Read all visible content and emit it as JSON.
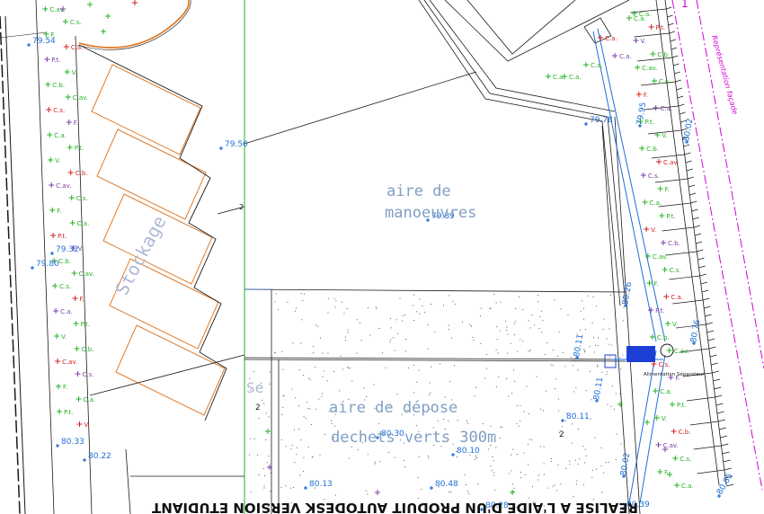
{
  "plan": {
    "areas": {
      "manoeuvre_line1": "aire de",
      "manoeuvre_line2": "manoeuvres",
      "depose_line1": "aire de dépose",
      "depose_line2": "dechets verts 300m",
      "depose_exp": "2",
      "stockage": "Stockage",
      "partial_se": "Se",
      "partial_2": "2"
    },
    "annotations": {
      "alimentation": "Alimentation Séparateur",
      "facade": "Représentation façade",
      "watermark": "REALISE A L'AIDE D'UN PRODUIT AUTODESK VERSION ETUDIANT",
      "red_number": "1"
    },
    "elevations": {
      "e1": "79.54",
      "e2": "79.50",
      "e3": "79.89",
      "e4": "79.32",
      "e5": "79.80",
      "e6": "79.78",
      "e7": "79.95",
      "e8": "80.02",
      "e9": "80.26",
      "e10": "80.11",
      "e11": "80.76",
      "e12": "80.11",
      "e13": "80.11",
      "e14": "80.30",
      "e15": "80.10",
      "e16": "80.33",
      "e17": "80.22",
      "e18": "80.13",
      "e19": "80.48",
      "e20": "80.28",
      "e21": "80.02",
      "e22": "80.39",
      "e23": "80.85"
    },
    "colors": {
      "line": "#1a1a1a",
      "blue": "#1e6fd6",
      "orange": "#e07b2a",
      "green": "#22b322",
      "red": "#d62020",
      "magenta": "#d400d4",
      "purple": "#7a3ea8",
      "arealabel": "#7f9fc4",
      "stockage": "#aeb8d6"
    }
  }
}
